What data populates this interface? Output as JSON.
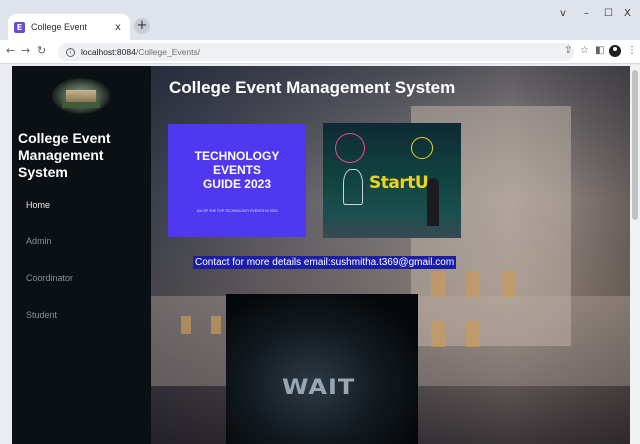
{
  "browser": {
    "tab_title": "College Event",
    "tab_favicon": "E",
    "tab_close": "x",
    "new_tab": "+",
    "url_host": "localhost:8084",
    "url_path": "/College_Events/",
    "window_controls": [
      "v",
      "–",
      "☐",
      "X"
    ]
  },
  "sidebar": {
    "title": "College Event Management System",
    "items": [
      {
        "label": "Home",
        "active": true
      },
      {
        "label": "Admin",
        "active": false
      },
      {
        "label": "Coordinator",
        "active": false
      },
      {
        "label": "Student",
        "active": false
      }
    ]
  },
  "main": {
    "heading": "College Event Management System",
    "card_tech": {
      "title_line1": "TECHNOLOGY",
      "title_line2": "EVENTS",
      "title_line3": "GUIDE 2023",
      "subtitle": "100 OF THE TOP TECHNOLOGY EVENTS IN 2023"
    },
    "card_startup_word": "StartU",
    "contact": "Contact for more details email:sushmitha.t369@gmail.com",
    "card_wait_word": "WAIT"
  },
  "colors": {
    "sidebar_bg": "#0b1015",
    "tech_card": "#5038f0",
    "contact_bg": "#1c1ea8",
    "startup_text": "#f3d21c"
  }
}
